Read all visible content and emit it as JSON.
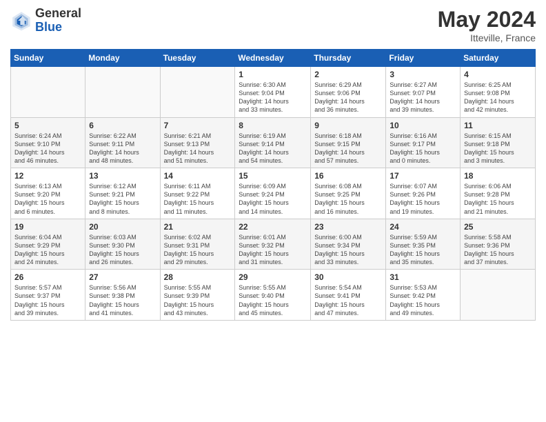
{
  "header": {
    "logo_general": "General",
    "logo_blue": "Blue",
    "title": "May 2024",
    "location": "Itteville, France"
  },
  "days_of_week": [
    "Sunday",
    "Monday",
    "Tuesday",
    "Wednesday",
    "Thursday",
    "Friday",
    "Saturday"
  ],
  "weeks": [
    {
      "row": 1,
      "days": [
        {
          "num": "",
          "info": ""
        },
        {
          "num": "",
          "info": ""
        },
        {
          "num": "",
          "info": ""
        },
        {
          "num": "1",
          "info": "Sunrise: 6:30 AM\nSunset: 9:04 PM\nDaylight: 14 hours\nand 33 minutes."
        },
        {
          "num": "2",
          "info": "Sunrise: 6:29 AM\nSunset: 9:06 PM\nDaylight: 14 hours\nand 36 minutes."
        },
        {
          "num": "3",
          "info": "Sunrise: 6:27 AM\nSunset: 9:07 PM\nDaylight: 14 hours\nand 39 minutes."
        },
        {
          "num": "4",
          "info": "Sunrise: 6:25 AM\nSunset: 9:08 PM\nDaylight: 14 hours\nand 42 minutes."
        }
      ]
    },
    {
      "row": 2,
      "days": [
        {
          "num": "5",
          "info": "Sunrise: 6:24 AM\nSunset: 9:10 PM\nDaylight: 14 hours\nand 46 minutes."
        },
        {
          "num": "6",
          "info": "Sunrise: 6:22 AM\nSunset: 9:11 PM\nDaylight: 14 hours\nand 48 minutes."
        },
        {
          "num": "7",
          "info": "Sunrise: 6:21 AM\nSunset: 9:13 PM\nDaylight: 14 hours\nand 51 minutes."
        },
        {
          "num": "8",
          "info": "Sunrise: 6:19 AM\nSunset: 9:14 PM\nDaylight: 14 hours\nand 54 minutes."
        },
        {
          "num": "9",
          "info": "Sunrise: 6:18 AM\nSunset: 9:15 PM\nDaylight: 14 hours\nand 57 minutes."
        },
        {
          "num": "10",
          "info": "Sunrise: 6:16 AM\nSunset: 9:17 PM\nDaylight: 15 hours\nand 0 minutes."
        },
        {
          "num": "11",
          "info": "Sunrise: 6:15 AM\nSunset: 9:18 PM\nDaylight: 15 hours\nand 3 minutes."
        }
      ]
    },
    {
      "row": 3,
      "days": [
        {
          "num": "12",
          "info": "Sunrise: 6:13 AM\nSunset: 9:20 PM\nDaylight: 15 hours\nand 6 minutes."
        },
        {
          "num": "13",
          "info": "Sunrise: 6:12 AM\nSunset: 9:21 PM\nDaylight: 15 hours\nand 8 minutes."
        },
        {
          "num": "14",
          "info": "Sunrise: 6:11 AM\nSunset: 9:22 PM\nDaylight: 15 hours\nand 11 minutes."
        },
        {
          "num": "15",
          "info": "Sunrise: 6:09 AM\nSunset: 9:24 PM\nDaylight: 15 hours\nand 14 minutes."
        },
        {
          "num": "16",
          "info": "Sunrise: 6:08 AM\nSunset: 9:25 PM\nDaylight: 15 hours\nand 16 minutes."
        },
        {
          "num": "17",
          "info": "Sunrise: 6:07 AM\nSunset: 9:26 PM\nDaylight: 15 hours\nand 19 minutes."
        },
        {
          "num": "18",
          "info": "Sunrise: 6:06 AM\nSunset: 9:28 PM\nDaylight: 15 hours\nand 21 minutes."
        }
      ]
    },
    {
      "row": 4,
      "days": [
        {
          "num": "19",
          "info": "Sunrise: 6:04 AM\nSunset: 9:29 PM\nDaylight: 15 hours\nand 24 minutes."
        },
        {
          "num": "20",
          "info": "Sunrise: 6:03 AM\nSunset: 9:30 PM\nDaylight: 15 hours\nand 26 minutes."
        },
        {
          "num": "21",
          "info": "Sunrise: 6:02 AM\nSunset: 9:31 PM\nDaylight: 15 hours\nand 29 minutes."
        },
        {
          "num": "22",
          "info": "Sunrise: 6:01 AM\nSunset: 9:32 PM\nDaylight: 15 hours\nand 31 minutes."
        },
        {
          "num": "23",
          "info": "Sunrise: 6:00 AM\nSunset: 9:34 PM\nDaylight: 15 hours\nand 33 minutes."
        },
        {
          "num": "24",
          "info": "Sunrise: 5:59 AM\nSunset: 9:35 PM\nDaylight: 15 hours\nand 35 minutes."
        },
        {
          "num": "25",
          "info": "Sunrise: 5:58 AM\nSunset: 9:36 PM\nDaylight: 15 hours\nand 37 minutes."
        }
      ]
    },
    {
      "row": 5,
      "days": [
        {
          "num": "26",
          "info": "Sunrise: 5:57 AM\nSunset: 9:37 PM\nDaylight: 15 hours\nand 39 minutes."
        },
        {
          "num": "27",
          "info": "Sunrise: 5:56 AM\nSunset: 9:38 PM\nDaylight: 15 hours\nand 41 minutes."
        },
        {
          "num": "28",
          "info": "Sunrise: 5:55 AM\nSunset: 9:39 PM\nDaylight: 15 hours\nand 43 minutes."
        },
        {
          "num": "29",
          "info": "Sunrise: 5:55 AM\nSunset: 9:40 PM\nDaylight: 15 hours\nand 45 minutes."
        },
        {
          "num": "30",
          "info": "Sunrise: 5:54 AM\nSunset: 9:41 PM\nDaylight: 15 hours\nand 47 minutes."
        },
        {
          "num": "31",
          "info": "Sunrise: 5:53 AM\nSunset: 9:42 PM\nDaylight: 15 hours\nand 49 minutes."
        },
        {
          "num": "",
          "info": ""
        }
      ]
    }
  ]
}
